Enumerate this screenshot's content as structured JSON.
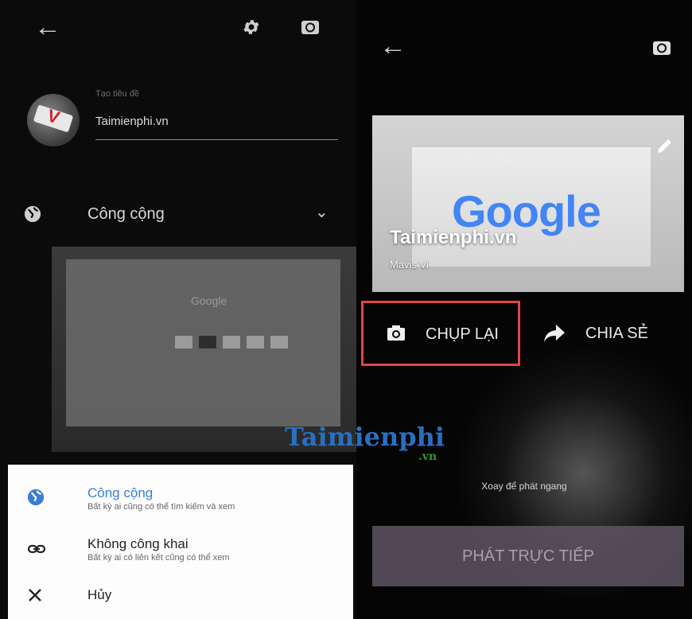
{
  "left": {
    "title_hint": "Tạo tiêu đề",
    "title_value": "Taimienphi.vn",
    "privacy_label": "Công cộng",
    "preview_text": "Google"
  },
  "menu": {
    "items": [
      {
        "title": "Công cộng",
        "subtitle": "Bất kỳ ai cũng có thể tìm kiếm và xem",
        "icon": "globe-icon"
      },
      {
        "title": "Không công khai",
        "subtitle": "Bất kỳ ai có liên kết cũng có thể xem",
        "icon": "link-icon"
      },
      {
        "title": "Hủy",
        "icon": "close-icon"
      }
    ]
  },
  "right": {
    "card_brand": "Google",
    "card_title": "Taimienphi.vn",
    "card_subtitle": "Mavis Vi",
    "retake_label": "CHỤP LẠI",
    "share_label": "CHIA SẺ",
    "rotate_hint": "Xoay để phát ngang",
    "live_label": "PHÁT TRỰC TIẾP"
  },
  "watermark": {
    "main": "Taimienphi",
    "sub": ".vn"
  },
  "colors": {
    "accent": "#3b7ed0",
    "highlight": "#e24545",
    "sheet_bg": "#fdfdfd"
  }
}
